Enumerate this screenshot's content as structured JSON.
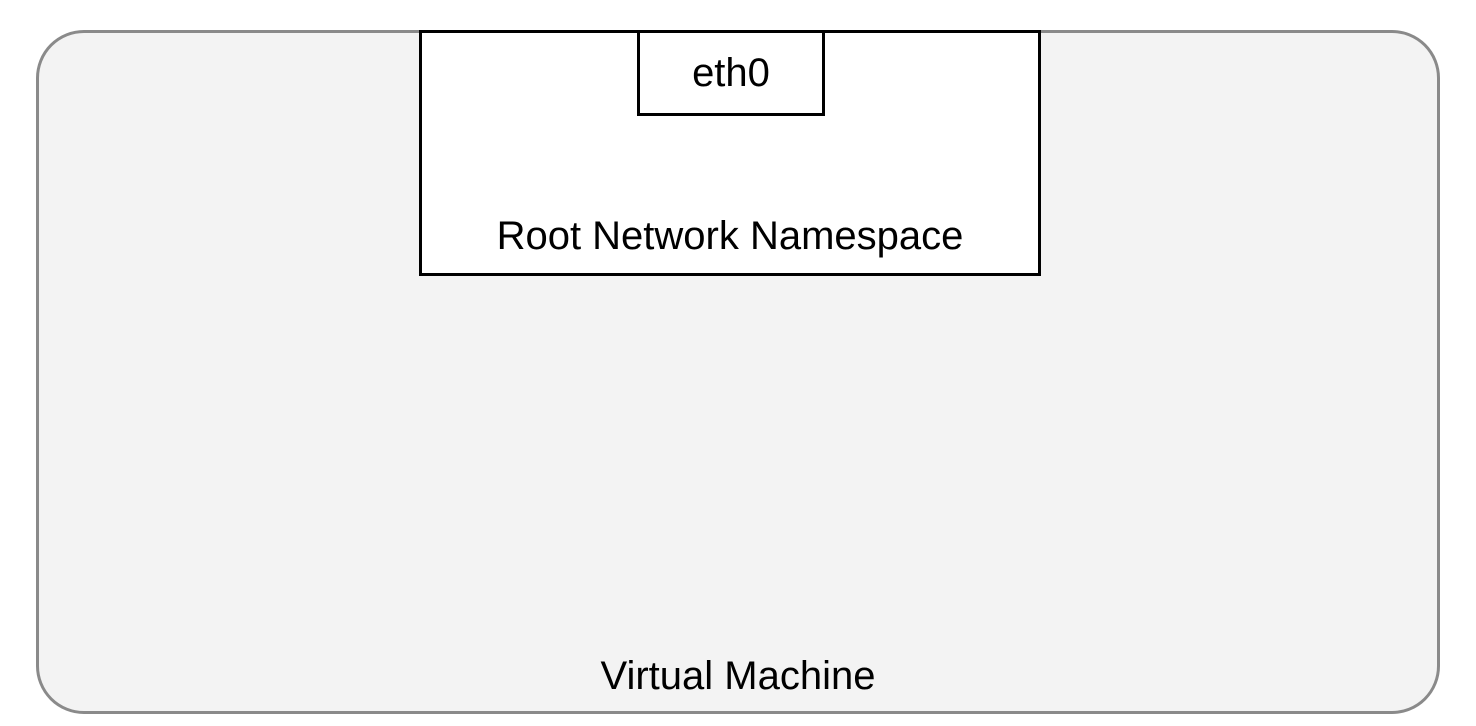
{
  "diagram": {
    "vm_label": "Virtual Machine",
    "root_namespace_label": "Root Network Namespace",
    "interface_label": "eth0"
  }
}
